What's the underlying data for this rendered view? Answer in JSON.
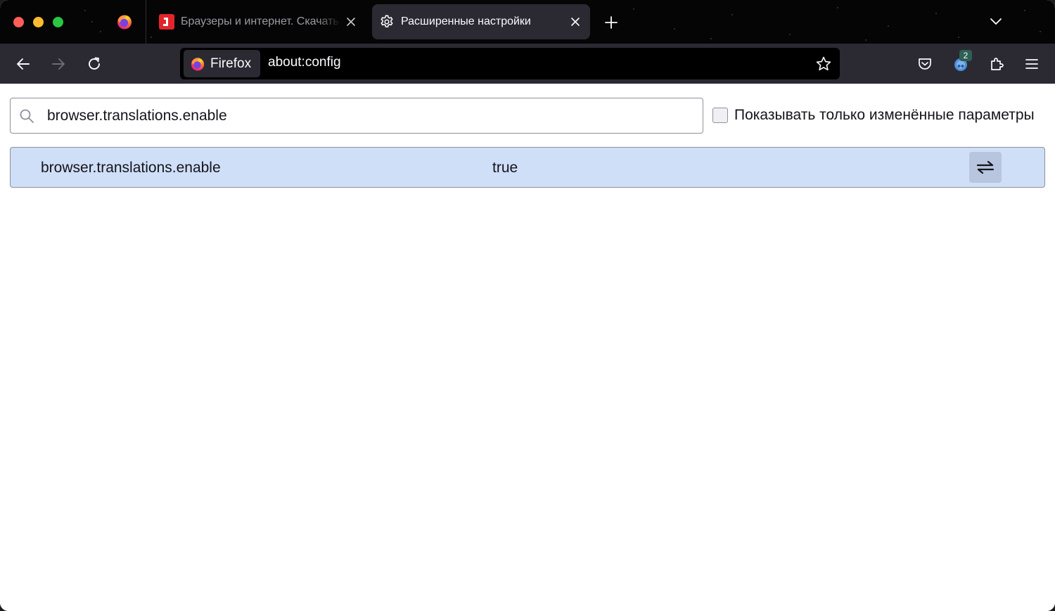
{
  "tabs": {
    "pinned_icon": "firefox-logo-icon",
    "items": [
      {
        "title": "Браузеры и интернет. Скачать",
        "icon": "site-favicon-icon",
        "active": false
      },
      {
        "title": "Расширенные настройки",
        "icon": "gear-icon",
        "active": true
      }
    ]
  },
  "navbar": {
    "identity_label": "Firefox",
    "url": "about:config",
    "addon_badge": "2"
  },
  "config": {
    "search_value": "browser.translations.enable",
    "show_modified_label": "Показывать только изменённые параметры",
    "show_modified_checked": false,
    "prefs": [
      {
        "name": "browser.translations.enable",
        "value": "true"
      }
    ]
  },
  "colors": {
    "tabstrip_bg": "#050505",
    "toolbar_bg": "#2b2a33",
    "urlbar_bg": "#000000",
    "row_highlight": "#cfdff8",
    "site_favicon": "#e3242b"
  }
}
